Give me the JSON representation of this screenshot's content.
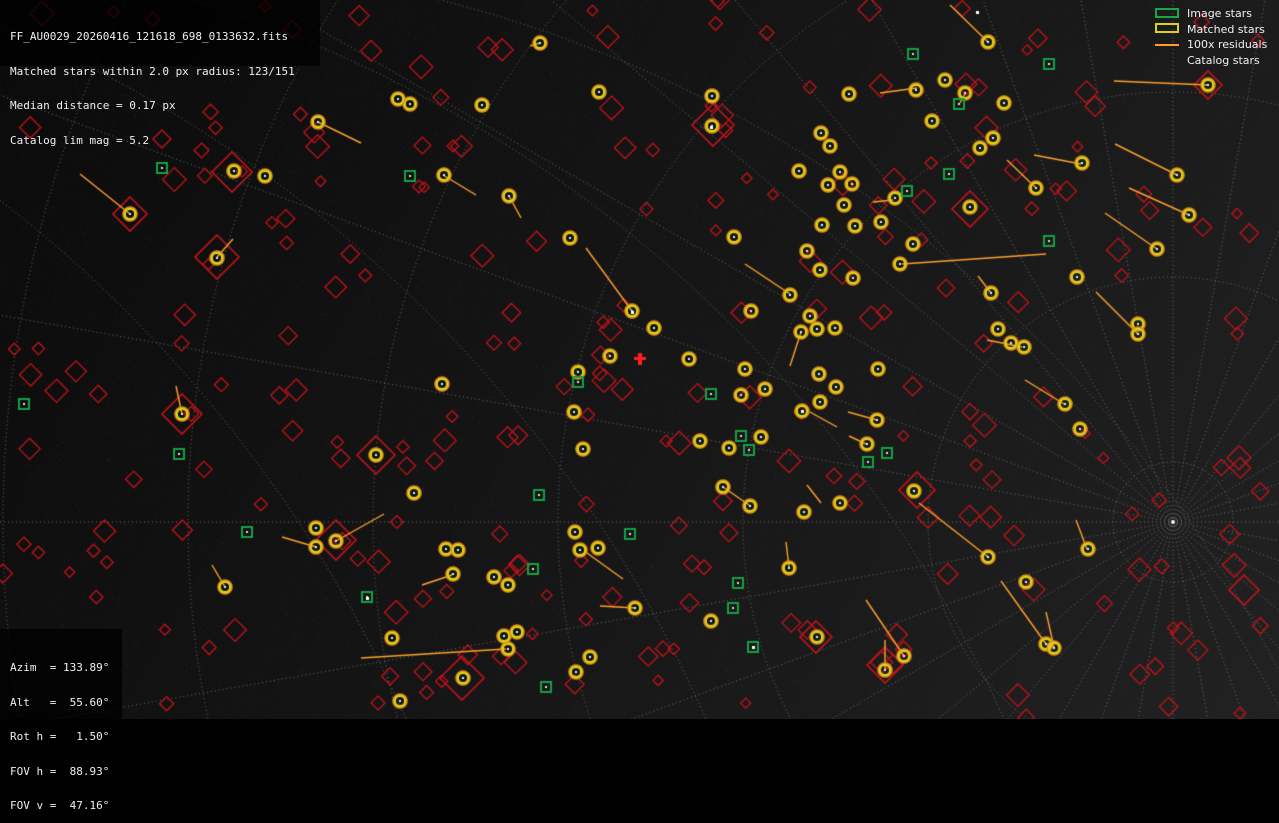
{
  "header": {
    "lines": [
      "FF_AU0029_20260416_121618_698_0133632.fits",
      "Matched stars within 2.0 px radius: 123/151",
      "Median distance = 0.17 px",
      "Catalog lim mag = 5.2"
    ]
  },
  "pointing": {
    "lines": [
      "Azim  = 133.89°",
      "Alt   =  55.60°",
      "Rot h =   1.50°",
      "FOV h =  88.93°",
      "FOV v =  47.16°"
    ]
  },
  "legend": {
    "items": [
      {
        "label": "Image stars",
        "icon": "green-square-icon"
      },
      {
        "label": "Matched stars",
        "icon": "yellow-box-icon"
      },
      {
        "label": "100x residuals",
        "icon": "orange-line-icon"
      },
      {
        "label": "Catalog stars",
        "icon": "blank-icon"
      }
    ]
  },
  "colors": {
    "catalog": "#c2131b",
    "matched": "#d9d51c",
    "matched_inner": "#e08a1a",
    "image_star": "#14a044",
    "residual": "#ff9f2a",
    "grid": "#6f6f6f",
    "center_marker": "#ff1f1f"
  }
}
